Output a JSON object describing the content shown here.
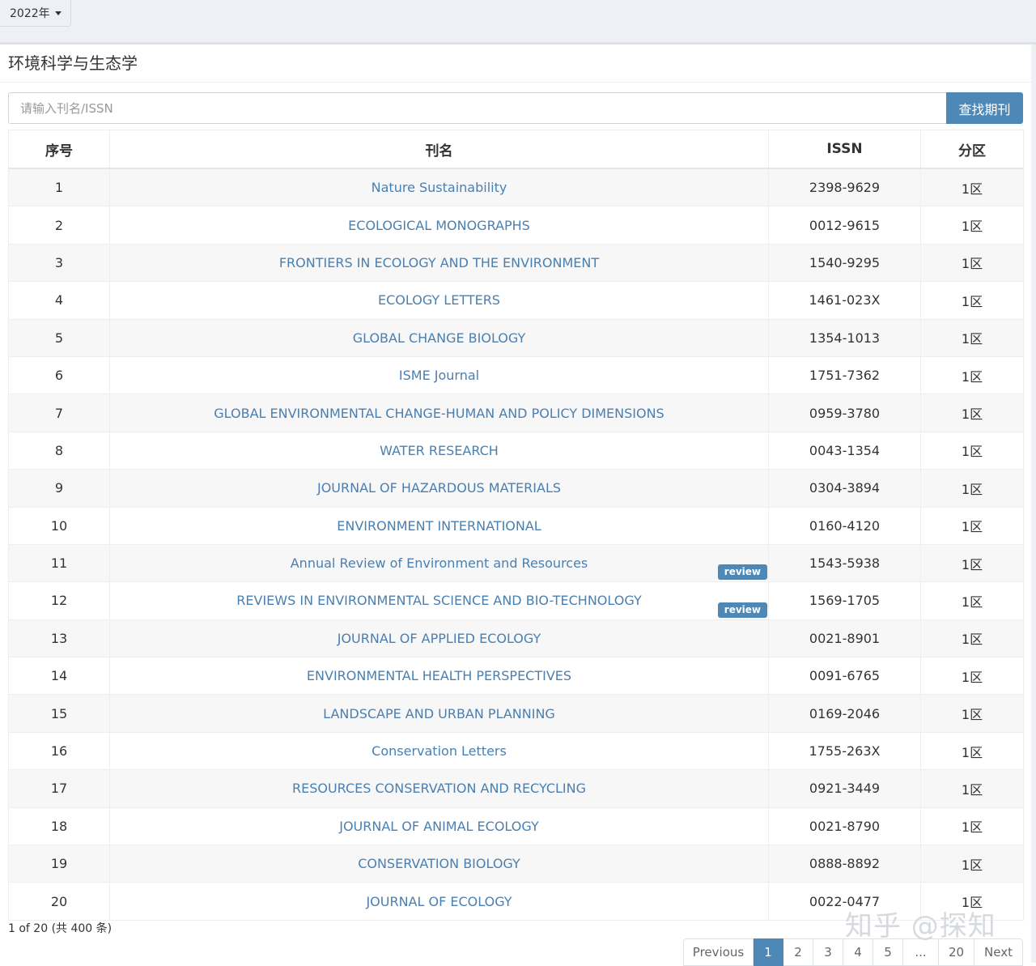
{
  "filter": {
    "year": "2022年"
  },
  "panel": {
    "title": "环境科学与生态学"
  },
  "search": {
    "placeholder": "请输入刊名/ISSN",
    "button": "查找期刊"
  },
  "table": {
    "headers": {
      "index": "序号",
      "name": "刊名",
      "issn": "ISSN",
      "zone": "分区"
    },
    "rows": [
      {
        "index": "1",
        "name": "Nature Sustainability",
        "issn": "2398-9629",
        "zone": "1区",
        "badge": ""
      },
      {
        "index": "2",
        "name": "ECOLOGICAL MONOGRAPHS",
        "issn": "0012-9615",
        "zone": "1区",
        "badge": ""
      },
      {
        "index": "3",
        "name": "FRONTIERS IN ECOLOGY AND THE ENVIRONMENT",
        "issn": "1540-9295",
        "zone": "1区",
        "badge": ""
      },
      {
        "index": "4",
        "name": "ECOLOGY LETTERS",
        "issn": "1461-023X",
        "zone": "1区",
        "badge": ""
      },
      {
        "index": "5",
        "name": "GLOBAL CHANGE BIOLOGY",
        "issn": "1354-1013",
        "zone": "1区",
        "badge": ""
      },
      {
        "index": "6",
        "name": "ISME Journal",
        "issn": "1751-7362",
        "zone": "1区",
        "badge": ""
      },
      {
        "index": "7",
        "name": "GLOBAL ENVIRONMENTAL CHANGE-HUMAN AND POLICY DIMENSIONS",
        "issn": "0959-3780",
        "zone": "1区",
        "badge": ""
      },
      {
        "index": "8",
        "name": "WATER RESEARCH",
        "issn": "0043-1354",
        "zone": "1区",
        "badge": ""
      },
      {
        "index": "9",
        "name": "JOURNAL OF HAZARDOUS MATERIALS",
        "issn": "0304-3894",
        "zone": "1区",
        "badge": ""
      },
      {
        "index": "10",
        "name": "ENVIRONMENT INTERNATIONAL",
        "issn": "0160-4120",
        "zone": "1区",
        "badge": ""
      },
      {
        "index": "11",
        "name": "Annual Review of Environment and Resources",
        "issn": "1543-5938",
        "zone": "1区",
        "badge": "review"
      },
      {
        "index": "12",
        "name": "REVIEWS IN ENVIRONMENTAL SCIENCE AND BIO-TECHNOLOGY",
        "issn": "1569-1705",
        "zone": "1区",
        "badge": "review"
      },
      {
        "index": "13",
        "name": "JOURNAL OF APPLIED ECOLOGY",
        "issn": "0021-8901",
        "zone": "1区",
        "badge": ""
      },
      {
        "index": "14",
        "name": "ENVIRONMENTAL HEALTH PERSPECTIVES",
        "issn": "0091-6765",
        "zone": "1区",
        "badge": ""
      },
      {
        "index": "15",
        "name": "LANDSCAPE AND URBAN PLANNING",
        "issn": "0169-2046",
        "zone": "1区",
        "badge": ""
      },
      {
        "index": "16",
        "name": "Conservation Letters",
        "issn": "1755-263X",
        "zone": "1区",
        "badge": ""
      },
      {
        "index": "17",
        "name": "RESOURCES CONSERVATION AND RECYCLING",
        "issn": "0921-3449",
        "zone": "1区",
        "badge": ""
      },
      {
        "index": "18",
        "name": "JOURNAL OF ANIMAL ECOLOGY",
        "issn": "0021-8790",
        "zone": "1区",
        "badge": ""
      },
      {
        "index": "19",
        "name": "CONSERVATION BIOLOGY",
        "issn": "0888-8892",
        "zone": "1区",
        "badge": ""
      },
      {
        "index": "20",
        "name": "JOURNAL OF ECOLOGY",
        "issn": "0022-0477",
        "zone": "1区",
        "badge": ""
      }
    ]
  },
  "summary": "1 of 20 (共 400 条)",
  "pagination": {
    "items": [
      {
        "label": "Previous",
        "active": false
      },
      {
        "label": "1",
        "active": true
      },
      {
        "label": "2",
        "active": false
      },
      {
        "label": "3",
        "active": false
      },
      {
        "label": "4",
        "active": false
      },
      {
        "label": "5",
        "active": false
      },
      {
        "label": "...",
        "active": false
      },
      {
        "label": "20",
        "active": false
      },
      {
        "label": "Next",
        "active": false
      }
    ]
  },
  "watermark": "知乎 @探知",
  "colors": {
    "accent": "#4e88b7",
    "link": "#4a7fb0"
  }
}
